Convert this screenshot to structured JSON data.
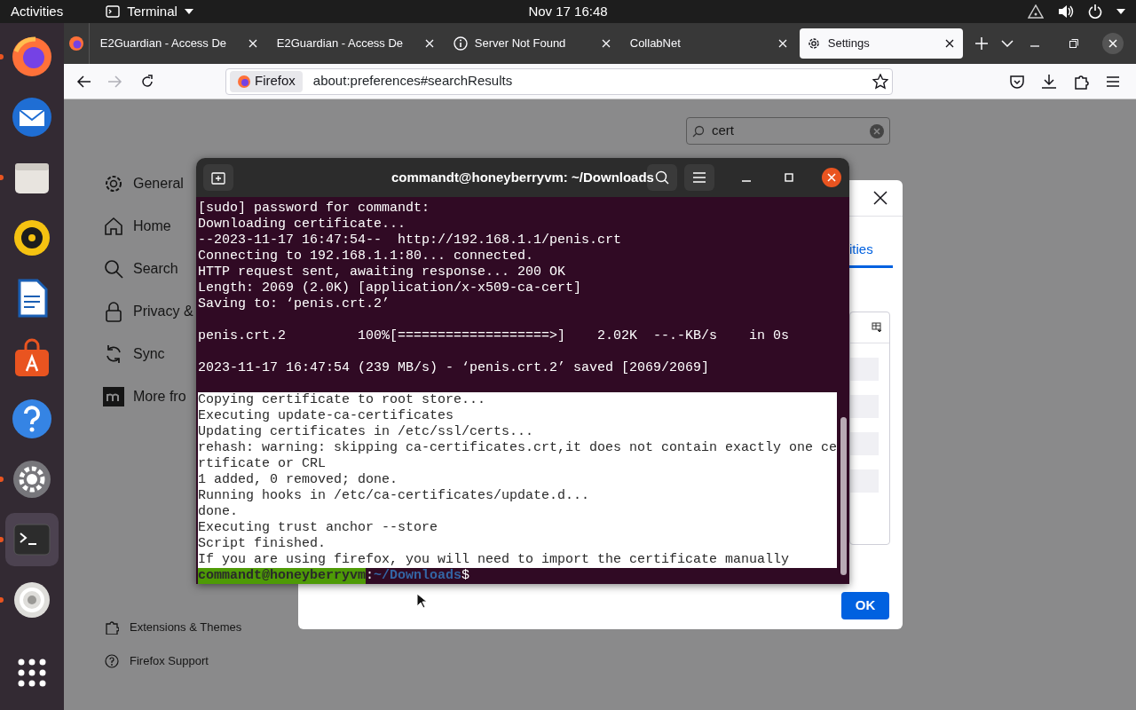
{
  "top_bar": {
    "activities": "Activities",
    "app_menu": "Terminal",
    "clock": "Nov 17  16:48"
  },
  "dock": [
    {
      "running": true,
      "selected": false
    },
    {
      "running": false,
      "selected": false
    },
    {
      "running": true,
      "selected": false
    },
    {
      "running": false,
      "selected": false
    },
    {
      "running": false,
      "selected": false
    },
    {
      "running": false,
      "selected": false
    },
    {
      "running": false,
      "selected": false
    },
    {
      "running": true,
      "selected": false
    },
    {
      "running": true,
      "selected": true
    },
    {
      "running": true,
      "selected": false
    }
  ],
  "browser": {
    "tabs": [
      {
        "title": "E2Guardian - Access De",
        "selected": false
      },
      {
        "title": "E2Guardian - Access De",
        "selected": false
      },
      {
        "title": "Server Not Found",
        "selected": false
      },
      {
        "title": "CollabNet",
        "selected": false
      },
      {
        "title": "Settings",
        "selected": true
      }
    ],
    "forward_disabled": true,
    "address": {
      "identity": "Firefox",
      "url": "about:preferences#searchResults"
    }
  },
  "settings": {
    "search": "cert",
    "categories": [
      {
        "label": "General"
      },
      {
        "label": "Home"
      },
      {
        "label": "Search"
      },
      {
        "label": "Privacy &"
      },
      {
        "label": "Sync"
      },
      {
        "label": "More fro"
      }
    ],
    "footer_links": [
      "Extensions & Themes",
      "Firefox Support"
    ]
  },
  "dialog": {
    "tab": "ities",
    "button": "OK"
  },
  "terminal": {
    "title": "commandt@honeyberryvm: ~/Downloads",
    "lines": [
      {
        "kind": "output",
        "text": "[sudo] password for commandt:",
        "selected": false
      },
      {
        "kind": "output",
        "text": "Downloading certificate...",
        "selected": false
      },
      {
        "kind": "output",
        "text": "--2023-11-17 16:47:54--  http://192.168.1.1/penis.crt",
        "selected": false
      },
      {
        "kind": "output",
        "text": "Connecting to 192.168.1.1:80... connected.",
        "selected": false
      },
      {
        "kind": "output",
        "text": "HTTP request sent, awaiting response... 200 OK",
        "selected": false
      },
      {
        "kind": "output",
        "text": "Length: 2069 (2.0K) [application/x-x509-ca-cert]",
        "selected": false
      },
      {
        "kind": "output",
        "text": "Saving to: ‘penis.crt.2’",
        "selected": false
      },
      {
        "kind": "blank",
        "selected": false
      },
      {
        "kind": "output",
        "text": "penis.crt.2         100%[===================>]    2.02K  --.-KB/s    in 0s",
        "selected": false
      },
      {
        "kind": "blank",
        "selected": false
      },
      {
        "kind": "output",
        "text": "2023-11-17 16:47:54 (239 MB/s) - ‘penis.crt.2’ saved [2069/2069]",
        "selected": false
      },
      {
        "kind": "blank",
        "selected": false
      },
      {
        "kind": "output",
        "text": "Copying certificate to root store...",
        "selected": true
      },
      {
        "kind": "output",
        "text": "Executing update-ca-certificates",
        "selected": true
      },
      {
        "kind": "output",
        "text": "Updating certificates in /etc/ssl/certs...",
        "selected": true
      },
      {
        "kind": "output",
        "text": "rehash: warning: skipping ca-certificates.crt,it does not contain exactly one ce",
        "selected": true
      },
      {
        "kind": "output",
        "text": "rtificate or CRL",
        "selected": true
      },
      {
        "kind": "output",
        "text": "1 added, 0 removed; done.",
        "selected": true
      },
      {
        "kind": "output",
        "text": "Running hooks in /etc/ca-certificates/update.d...",
        "selected": true
      },
      {
        "kind": "output",
        "text": "done.",
        "selected": true
      },
      {
        "kind": "output",
        "text": "Executing trust anchor --store",
        "selected": true
      },
      {
        "kind": "output",
        "text": "Script finished.",
        "selected": true
      },
      {
        "kind": "output",
        "text": "If you are using firefox, you will need to import the certificate manually",
        "selected": true
      }
    ],
    "prompt": {
      "user": "commandt@honeyberryvm",
      "separator": ":",
      "path": "~/Downloads",
      "symbol": "$"
    }
  }
}
